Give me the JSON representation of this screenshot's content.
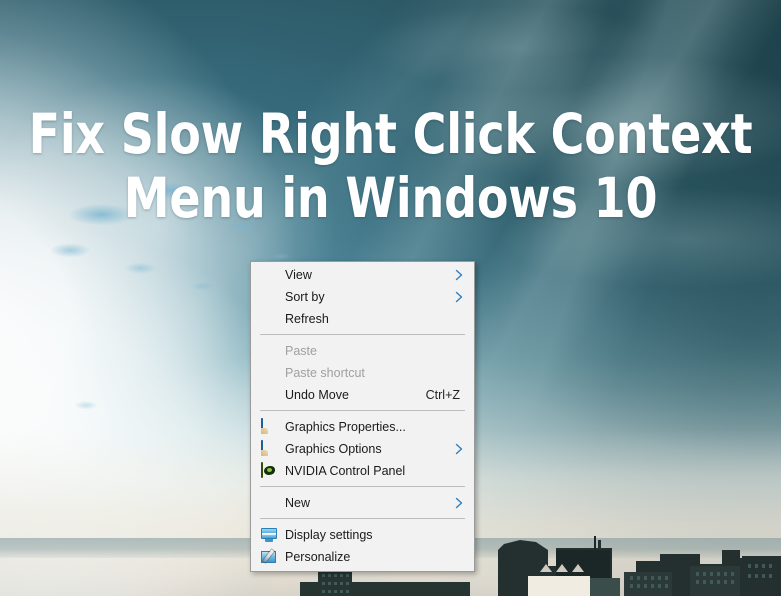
{
  "page": {
    "heading": "Fix Slow Right Click Context Menu in Windows 10"
  },
  "colors": {
    "menu_background": "#f2f2f2",
    "menu_border": "#9a9a9a",
    "menu_text": "#1a1a1a",
    "menu_text_disabled": "#a0a0a0",
    "chevron": "#2f7fc1",
    "heading_text": "#ffffff",
    "sky_teal": "#3d7485",
    "sky_dark": "#2f5d6b"
  },
  "context_menu": {
    "groups": [
      {
        "items": [
          {
            "label": "View",
            "icon": null,
            "submenu": true,
            "disabled": false,
            "accelerator": ""
          },
          {
            "label": "Sort by",
            "icon": null,
            "submenu": true,
            "disabled": false,
            "accelerator": ""
          },
          {
            "label": "Refresh",
            "icon": null,
            "submenu": false,
            "disabled": false,
            "accelerator": ""
          }
        ]
      },
      {
        "items": [
          {
            "label": "Paste",
            "icon": null,
            "submenu": false,
            "disabled": true,
            "accelerator": ""
          },
          {
            "label": "Paste shortcut",
            "icon": null,
            "submenu": false,
            "disabled": true,
            "accelerator": ""
          },
          {
            "label": "Undo Move",
            "icon": null,
            "submenu": false,
            "disabled": false,
            "accelerator": "Ctrl+Z"
          }
        ]
      },
      {
        "items": [
          {
            "label": "Graphics Properties...",
            "icon": "graphics-properties-icon",
            "submenu": false,
            "disabled": false,
            "accelerator": ""
          },
          {
            "label": "Graphics Options",
            "icon": "graphics-options-icon",
            "submenu": true,
            "disabled": false,
            "accelerator": ""
          },
          {
            "label": "NVIDIA Control Panel",
            "icon": "nvidia-control-panel-icon",
            "submenu": false,
            "disabled": false,
            "accelerator": ""
          }
        ]
      },
      {
        "items": [
          {
            "label": "New",
            "icon": null,
            "submenu": true,
            "disabled": false,
            "accelerator": ""
          }
        ]
      },
      {
        "items": [
          {
            "label": "Display settings",
            "icon": "display-settings-icon",
            "submenu": false,
            "disabled": false,
            "accelerator": ""
          },
          {
            "label": "Personalize",
            "icon": "personalize-icon",
            "submenu": false,
            "disabled": false,
            "accelerator": ""
          }
        ]
      }
    ]
  }
}
